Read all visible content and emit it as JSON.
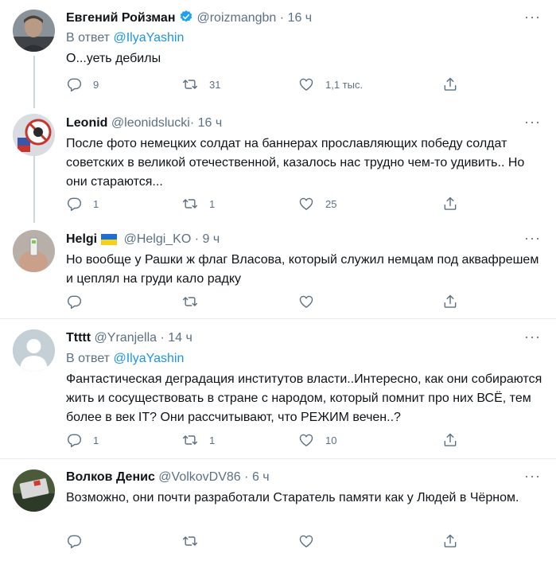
{
  "tweets": [
    {
      "name": "Евгений Ройзман",
      "verified": true,
      "handle": "@roizmangbn",
      "dot": "·",
      "time": "16 ч",
      "reply_prefix": "В ответ",
      "reply_to": "@IlyaYashin",
      "text": "О...уеть дебилы",
      "replies": "9",
      "retweets": "31",
      "likes": "1,1 тыс."
    },
    {
      "name": "Leonid",
      "handle": "@leonidslucki",
      "dot": "·",
      "time": "16 ч",
      "text": "После фото немецких солдат на баннерах прославляющих победу солдат советских в великой отечественной, казалось нас трудно чем-то удивить.. Но они стараются...",
      "replies": "1",
      "retweets": "1",
      "likes": "25"
    },
    {
      "name": "Helgi",
      "flag": "ukraine-flag",
      "handle": "@Helgi_KO",
      "dot": "·",
      "time": "9 ч",
      "text": "Но вообще у Рашки ж флаг Власова, который служил немцам под аквафрешем и цеплял на груди кало радку",
      "replies": "",
      "retweets": "",
      "likes": ""
    },
    {
      "name": "Ttttt",
      "handle": "@Yranjella",
      "dot": "·",
      "time": "14 ч",
      "reply_prefix": "В ответ",
      "reply_to": "@IlyaYashin",
      "text": "Фантастическая деградация институтов власти..Интересно, как они собираются жить и сосуществовать в стране с народом, который помнит про них ВСЁ, тем более в век IT? Они рассчитывают, что РЕЖИМ вечен..?",
      "replies": "1",
      "retweets": "1",
      "likes": "10"
    },
    {
      "name": "Волков Денис",
      "handle": "@VolkovDV86",
      "dot": "·",
      "time": "6 ч",
      "text": "Возможно, они почти разработали Старатель памяти как у Людей в Чёрном.",
      "replies": "",
      "retweets": "",
      "likes": ""
    }
  ],
  "icons": {
    "more": "more-icon",
    "reply": "reply-icon",
    "retweet": "retweet-icon",
    "like": "heart-icon",
    "share": "share-icon",
    "verified": "verified-badge-icon"
  },
  "colors": {
    "link": "#1b95e0",
    "muted": "#5b7083",
    "divider": "#e6ecf0",
    "thread_line": "#ccd6dd"
  }
}
